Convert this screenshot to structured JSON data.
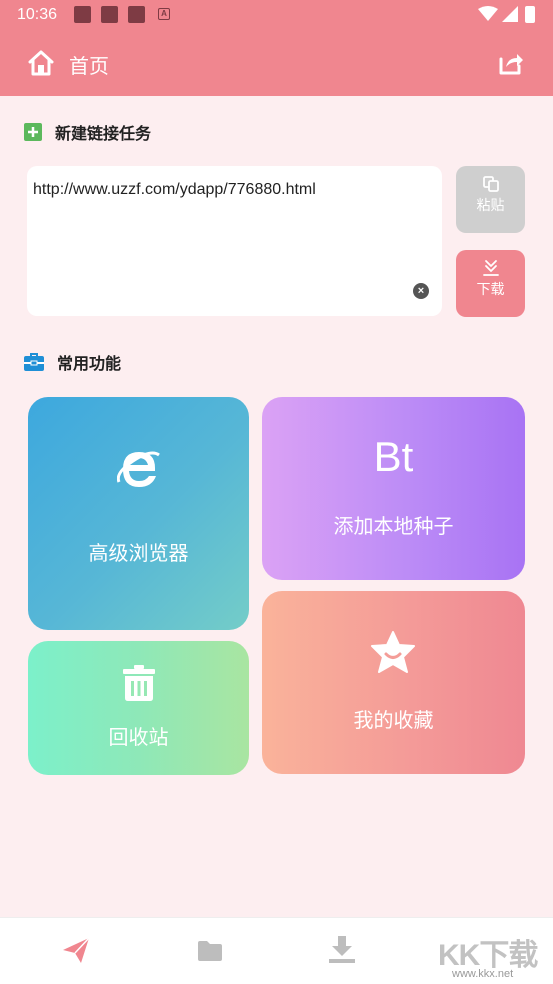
{
  "status_bar": {
    "time": "10:36"
  },
  "header": {
    "title": "首页"
  },
  "section_new_task": {
    "title": "新建链接任务"
  },
  "url_input": {
    "value": "http://www.uzzf.com/ydapp/776880.html"
  },
  "buttons": {
    "paste": "粘贴",
    "download": "下载"
  },
  "section_common": {
    "title": "常用功能"
  },
  "cards": {
    "browser": "高级浏览器",
    "bt_text": "Bt",
    "bt": "添加本地种子",
    "trash": "回收站",
    "favorites": "我的收藏"
  },
  "watermark": {
    "logo_text": "KK下载",
    "url": "www.kkx.net"
  },
  "colors": {
    "header": "#f0868f",
    "background": "#fdeef0",
    "accent": "#f0868f",
    "disabled": "#cfcfcf"
  },
  "icons": {
    "header_left": "home-icon",
    "header_right": "share-icon",
    "nav": [
      "send-icon",
      "folder-icon",
      "download-icon"
    ]
  }
}
